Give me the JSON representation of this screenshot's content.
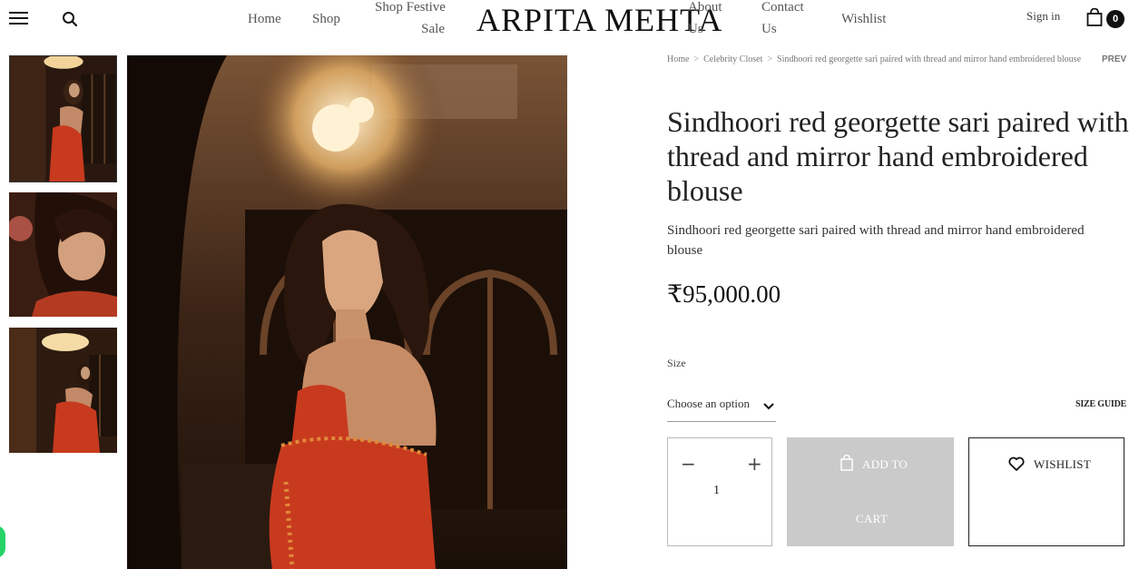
{
  "header": {
    "logo": "ARPITA MEHTA",
    "nav": {
      "home": "Home",
      "shop": "Shop",
      "shop_festive_line1": "Shop Festive",
      "shop_festive_line2": "Sale",
      "about_line1": "About",
      "about_line2": "Us",
      "contact_line1": "Contact",
      "contact_line2": "Us",
      "wishlist": "Wishlist"
    },
    "sign_in": "Sign in",
    "cart_count": "0",
    "icons": [
      "menu-icon",
      "search-icon",
      "shopping-bag-icon"
    ]
  },
  "gallery": {
    "thumbnails": [
      "thumbnail-1",
      "thumbnail-2",
      "thumbnail-3"
    ],
    "main_image": "main-product-image"
  },
  "breadcrumb": {
    "items": [
      "Home",
      "Celebrity Closet",
      "Sindhoori red georgette sari paired with thread and mirror hand embroidered blouse"
    ],
    "prev": "PREV"
  },
  "product": {
    "title": "Sindhoori red georgette sari paired with thread and mirror hand embroidered blouse",
    "description": "Sindhoori red georgette sari paired with thread and mirror hand embroidered blouse",
    "price": "₹95,000.00",
    "size_label": "Size",
    "size_placeholder": "Choose an option",
    "size_guide": "SIZE GUIDE",
    "quantity": "1",
    "add_to_cart_line1": "ADD TO",
    "add_to_cart_line2": "CART",
    "wishlist": "WISHLIST"
  },
  "colors": {
    "accent": "#111111",
    "button_disabled": "#cacaca",
    "whatsapp": "#25d366",
    "sari_red": "#c83a1e"
  }
}
